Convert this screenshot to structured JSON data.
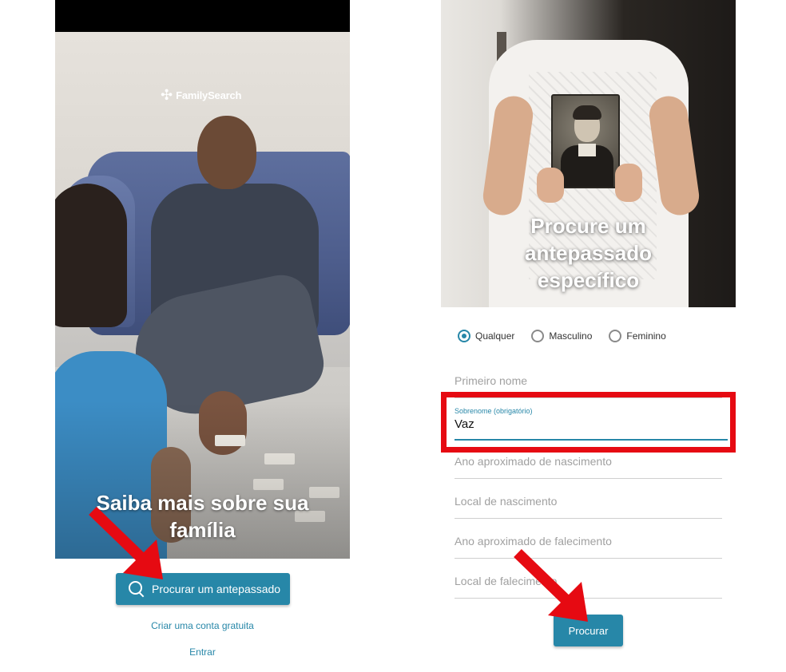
{
  "left_screen": {
    "logo_text": "FamilySearch",
    "hero_title_line1": "Saiba mais sobre sua",
    "hero_title_line2": "família",
    "search_button_label": "Procurar um antepassado",
    "create_account_link": "Criar uma conta gratuita",
    "login_link": "Entrar"
  },
  "right_screen": {
    "hero_title_line1": "Procure um",
    "hero_title_line2": "antepassado",
    "hero_title_line3": "específico",
    "gender_options": [
      {
        "label": "Qualquer",
        "selected": true
      },
      {
        "label": "Masculino",
        "selected": false
      },
      {
        "label": "Feminino",
        "selected": false
      }
    ],
    "first_name_placeholder": "Primeiro nome",
    "surname_label": "Sobrenome (obrigatório)",
    "surname_value": "Vaz",
    "birth_year_placeholder": "Ano aproximado de nascimento",
    "birth_place_placeholder": "Local de nascimento",
    "death_year_placeholder": "Ano aproximado de falecimento",
    "death_place_placeholder": "Local de falecimento",
    "submit_button_label": "Procurar"
  },
  "colors": {
    "brand_blue": "#2787a8",
    "highlight_red": "#e60a12",
    "annotation_arrow": "#e60a12"
  }
}
